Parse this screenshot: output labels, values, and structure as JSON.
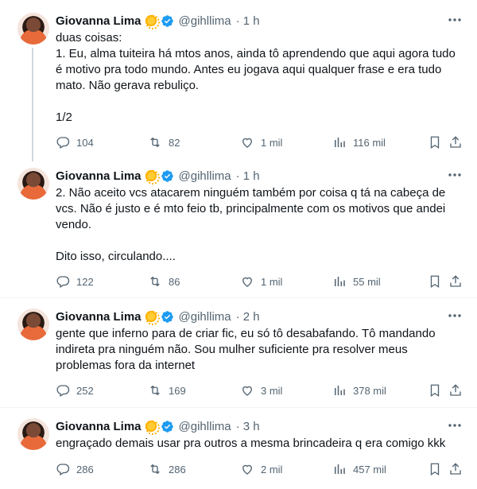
{
  "tweets": [
    {
      "name": "Giovanna Lima",
      "handle": "@gihllima",
      "time": "· 1 h",
      "text": "duas coisas:\n1. Eu, alma tuiteira há mtos anos, ainda tô aprendendo que aqui agora tudo\né motivo pra todo mundo. Antes eu jogava aqui qualquer frase e era tudo\nmato. Não gerava rebuliço.\n\n1/2",
      "replies": "104",
      "retweets": "82",
      "likes": "1 mil",
      "views": "116 mil"
    },
    {
      "name": "Giovanna Lima",
      "handle": "@gihllima",
      "time": "· 1 h",
      "text": "2. Não aceito vcs atacarem ninguém também por coisa q tá na cabeça de\nvcs. Não é justo e é mto feio tb, principalmente com os motivos que andei\nvendo.\n\nDito isso, circulando....",
      "replies": "122",
      "retweets": "86",
      "likes": "1 mil",
      "views": "55 mil"
    },
    {
      "name": "Giovanna Lima",
      "handle": "@gihllima",
      "time": "· 2 h",
      "text": "gente que inferno para de criar fic, eu só tô desabafando. Tô mandando\nindireta pra ninguém não. Sou mulher suficiente pra resolver meus\nproblemas fora da internet",
      "replies": "252",
      "retweets": "169",
      "likes": "3 mil",
      "views": "378 mil"
    },
    {
      "name": "Giovanna Lima",
      "handle": "@gihllima",
      "time": "· 3 h",
      "text": "engraçado demais usar pra outros a mesma brincadeira q era comigo kkk",
      "replies": "286",
      "retweets": "286",
      "likes": "2 mil",
      "views": "457 mil"
    }
  ],
  "icons": {
    "reply": "reply-icon",
    "retweet": "retweet-icon",
    "like": "heart-icon",
    "views": "views-icon",
    "bookmark": "bookmark-icon",
    "share": "share-icon",
    "more": "more-icon",
    "verified": "verified-badge-icon",
    "emoji": "sun-emoji-icon"
  },
  "colors": {
    "verified": "#1d9bf0",
    "secondary": "#536471",
    "thread_line": "#cfd9de"
  }
}
